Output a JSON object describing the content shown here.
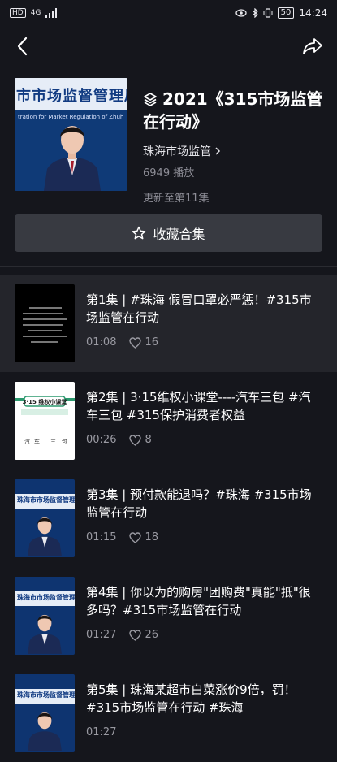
{
  "status_bar": {
    "network": "HD",
    "signal_type": "4G",
    "battery": "50",
    "time": "14:24"
  },
  "collection": {
    "title": "2021《315市场监管在行动》",
    "author": "珠海市场监管",
    "plays": "6949 播放",
    "updated": "更新至第11集",
    "cover_band_text": "市市场监督管理局",
    "cover_sub_text": "tration for Market Regulation of Zhuh"
  },
  "favorite_button": {
    "label": "收藏合集"
  },
  "episodes": [
    {
      "title": "第1集 | #珠海 假冒口罩必严惩！#315市场监管在行动",
      "duration": "01:08",
      "likes": "16"
    },
    {
      "title": "第2集 | 3·15维权小课堂----汽车三包 #汽车三包 #315保护消费者权益",
      "duration": "00:26",
      "likes": "8"
    },
    {
      "title": "第3集 | 预付款能退吗？#珠海 #315市场监管在行动",
      "duration": "01:15",
      "likes": "18"
    },
    {
      "title": "第4集 | 你以为的购房\"团购费\"真能\"抵\"很多吗？#315市场监管在行动",
      "duration": "01:27",
      "likes": "26"
    },
    {
      "title": "第5集 | 珠海某超市白菜涨价9倍，罚！#315市场监管在行动 #珠海",
      "duration": "01:27",
      "likes": ""
    }
  ],
  "thumb_texts": {
    "ep2_label": "3·15 维权小课堂",
    "ep2_words": [
      "汽",
      "车",
      "三",
      "包"
    ],
    "ep3_band": "珠海市市场监督管理局"
  },
  "colors": {
    "background": "#15161c",
    "button": "#383a41",
    "active_row": "#24252b"
  }
}
